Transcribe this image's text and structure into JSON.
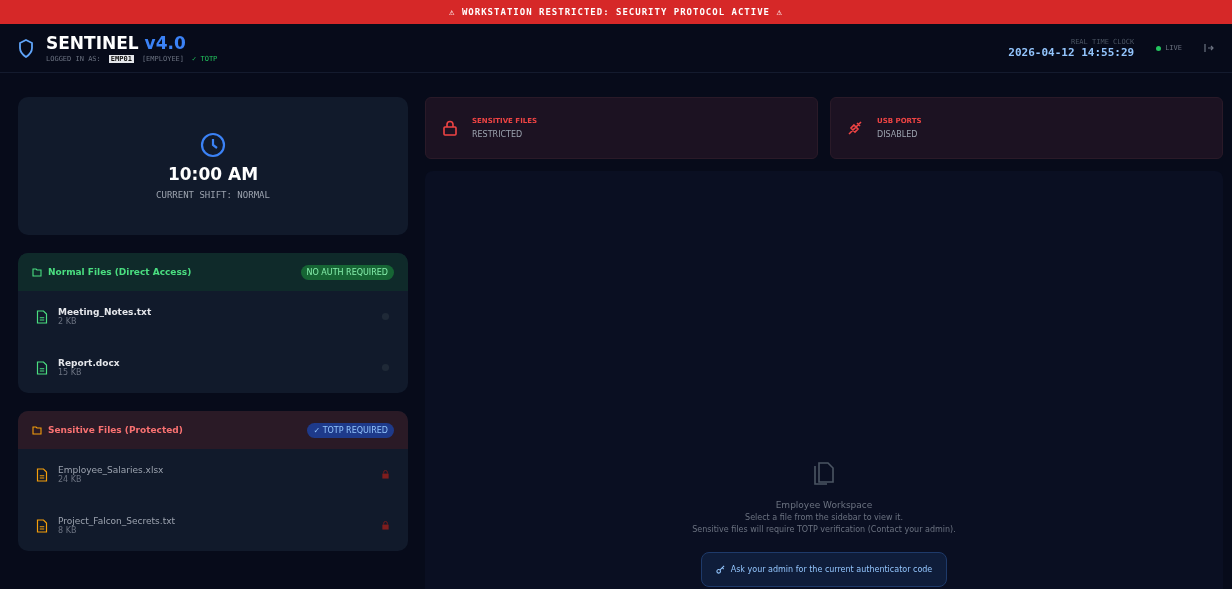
{
  "banner": "⚠ WORKSTATION RESTRICTED: SECURITY PROTOCOL ACTIVE ⚠",
  "header": {
    "title": "SENTINEL",
    "version": "v4.0",
    "login_label": "LOGGED IN AS:",
    "user": "EMP01",
    "role": "[EMPLOYEE]",
    "auth": "✓ TOTP",
    "clock_label": "REAL TIME CLOCK",
    "clock": "2026-04-12 14:55:29",
    "live": "LIVE"
  },
  "shift": {
    "time": "10:00 AM",
    "label": "CURRENT SHIFT: NORMAL"
  },
  "sections": [
    {
      "kind": "normal",
      "title": "Normal Files (Direct Access)",
      "badge": "NO AUTH REQUIRED",
      "files": [
        {
          "name": "Meeting_Notes.txt",
          "size": "2 KB",
          "locked": false
        },
        {
          "name": "Report.docx",
          "size": "15 KB",
          "locked": false
        }
      ]
    },
    {
      "kind": "sensitive",
      "title": "Sensitive Files (Protected)",
      "badge": "✓ TOTP REQUIRED",
      "files": [
        {
          "name": "Employee_Salaries.xlsx",
          "size": "24 KB",
          "locked": true
        },
        {
          "name": "Project_Falcon_Secrets.txt",
          "size": "8 KB",
          "locked": true
        }
      ]
    }
  ],
  "status_cards": [
    {
      "kind": "lock",
      "title": "SENSITIVE FILES",
      "value": "RESTRICTED"
    },
    {
      "kind": "usb",
      "title": "USB PORTS",
      "value": "DISABLED"
    }
  ],
  "workspace": {
    "title": "Employee Workspace",
    "lines": [
      "Select a file from the sidebar to view it.",
      "Sensitive files will require TOTP verification (Contact your admin)."
    ],
    "hint": "Ask your admin for the current authenticator code"
  }
}
